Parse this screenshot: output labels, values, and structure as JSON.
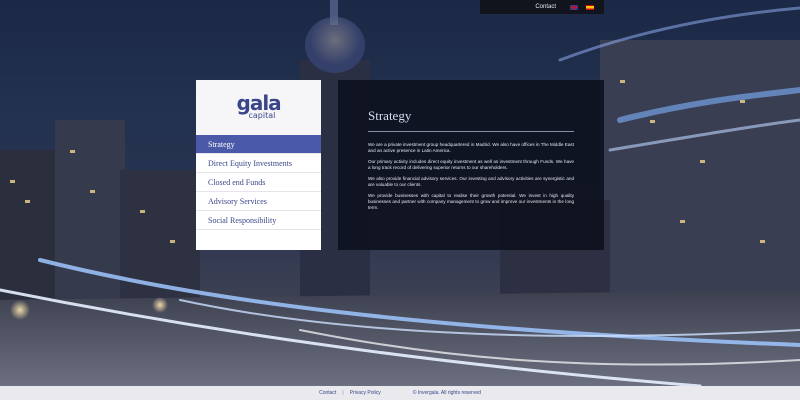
{
  "topbar": {
    "contact_label": "Contact",
    "languages": [
      "en-flag-icon",
      "es-flag-icon"
    ]
  },
  "logo": {
    "word": "gala",
    "sub": "capital"
  },
  "menu": {
    "items": [
      {
        "label": "Strategy",
        "active": true
      },
      {
        "label": "Direct Equity Investments",
        "active": false
      },
      {
        "label": "Closed end Funds",
        "active": false
      },
      {
        "label": "Advisory Services",
        "active": false
      },
      {
        "label": "Social Responsibility",
        "active": false
      }
    ]
  },
  "content": {
    "title": "Strategy",
    "paragraphs": [
      "We are a private investment group headquartered in Madrid. We also have offices in The Middle East and an active presence in Latin America.",
      "Our primary activity includes direct equity investment as well as investment through Funds. We have a long track record of delivering superior returns to our shareholders.",
      "We also provide financial advisory services. Our investing and advisory activities are synergistic and are valuable to our clients.",
      "We provide businesses with capital to realise their growth potential. We invest in high quality businesses and partner with company management to grow and improve our investments in the long term."
    ]
  },
  "footer": {
    "contact_label": "Contact",
    "separator": "|",
    "privacy_label": "Privacy Policy",
    "copyright": "© Invergala. All rights reserved"
  },
  "colors": {
    "brand": "#3a4689",
    "active_menu": "#4a5aa8",
    "panel_dark": "#0c101c"
  }
}
